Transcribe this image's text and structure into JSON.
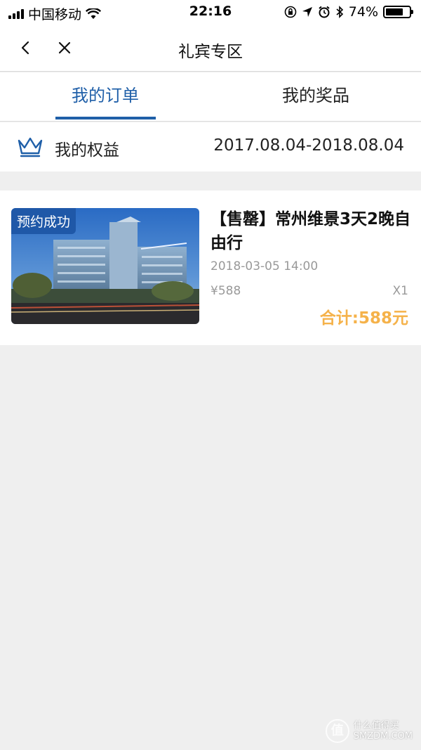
{
  "status_bar": {
    "carrier": "中国移动",
    "time": "22:16",
    "battery": "74%",
    "battery_level": 0.74
  },
  "nav": {
    "title": "礼宾专区"
  },
  "tabs": [
    {
      "label": "我的订单",
      "active": true
    },
    {
      "label": "我的奖品",
      "active": false
    }
  ],
  "benefits": {
    "label": "我的权益",
    "dates": "2017.08.04-2018.08.04"
  },
  "order": {
    "status_badge": "预约成功",
    "title": "【售罄】常州维景3天2晚自由行",
    "time": "2018-03-05 14:00",
    "price": "¥588",
    "quantity": "X1",
    "total": "合计:588元"
  },
  "watermark": {
    "logo": "值",
    "line1": "什么值得买",
    "line2": "SMZDM.COM"
  },
  "colors": {
    "accent": "#1f5fa8",
    "total": "#f5b24a",
    "background": "#efefef"
  }
}
